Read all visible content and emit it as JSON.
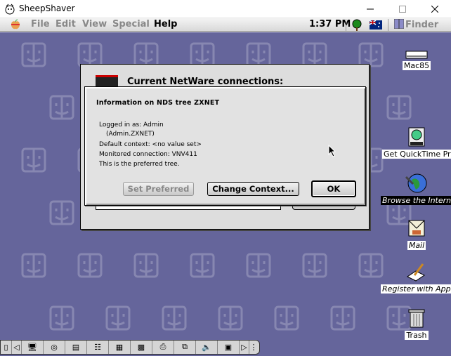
{
  "window": {
    "title": "SheepShaver"
  },
  "menubar": {
    "items": [
      "File",
      "Edit",
      "View",
      "Special",
      "Help"
    ],
    "clock": "1:37 PM",
    "active_app": "Finder"
  },
  "back_window": {
    "title": "Current NetWare connections:"
  },
  "dialog": {
    "title": "Information on NDS tree ZXNET",
    "lines": [
      "Logged in as: Admin",
      "(Admin.ZXNET)",
      "Default context: <no value set>",
      "Monitored connection: VNV411",
      "This is the preferred tree."
    ],
    "buttons": {
      "set_preferred": "Set Preferred",
      "change_context": "Change Context...",
      "ok": "OK"
    }
  },
  "desktop_icons": [
    {
      "label": "Mac85",
      "icon": "disk-icon"
    },
    {
      "label": "Get QuickTime Pro",
      "icon": "quicktime-icon"
    },
    {
      "label": "Browse the Internet",
      "icon": "globe-icon"
    },
    {
      "label": "Mail",
      "icon": "mail-icon"
    },
    {
      "label": "Register with Apple",
      "icon": "register-icon"
    },
    {
      "label": "Trash",
      "icon": "trash-icon"
    }
  ],
  "colors": {
    "desktop": "#65659b",
    "menubar": "#e6e6e6"
  }
}
